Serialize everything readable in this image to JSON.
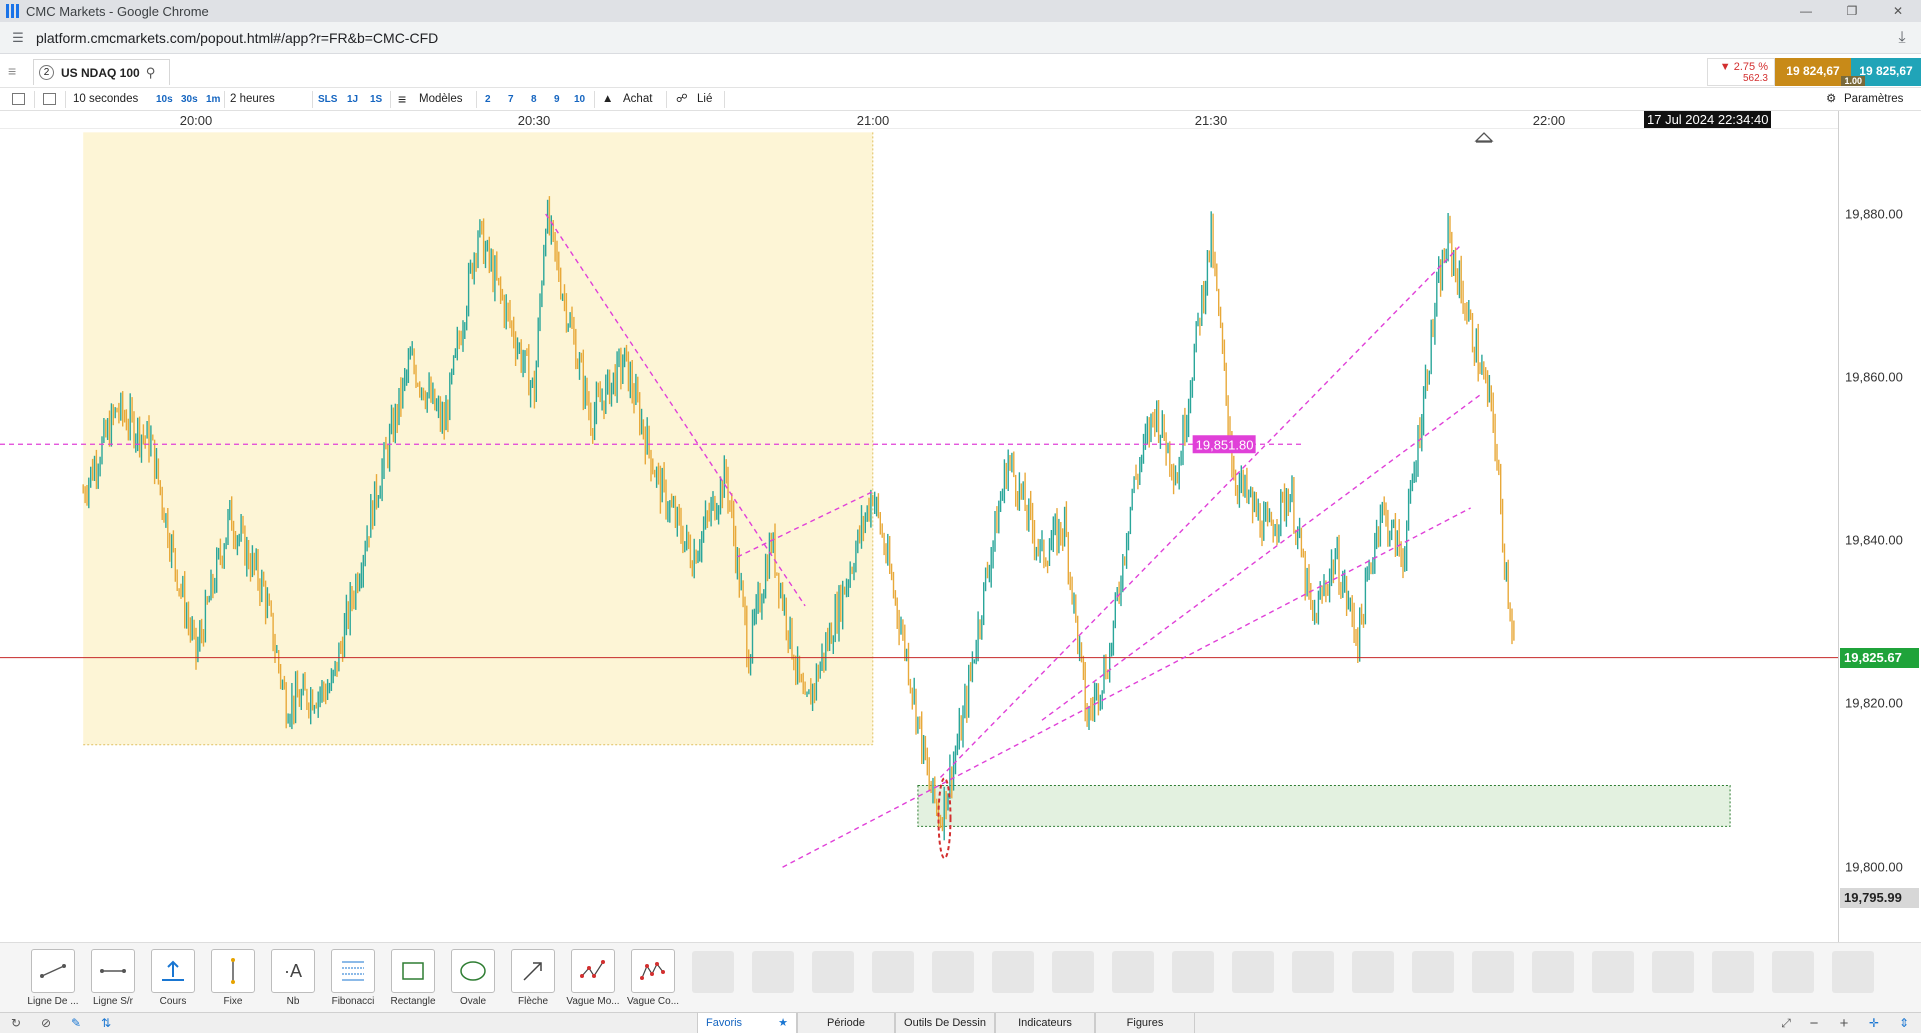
{
  "window": {
    "title": "CMC Markets - Google Chrome",
    "url": "platform.cmcmarkets.com/popout.html#/app?r=FR&b=CMC-CFD"
  },
  "instrument": {
    "number": "2",
    "name": "US NDAQ 100",
    "change_pct": "▼ 2.75 %",
    "change_pts": "562.3",
    "sell": "19 824,67",
    "buy": "19 825,67",
    "spread": "1.00"
  },
  "toolbar": {
    "interval": "10 secondes",
    "interval_options": [
      "10s",
      "30s",
      "1m"
    ],
    "span": "2 heures",
    "span_options": [
      "SLS",
      "1J",
      "1S"
    ],
    "templates": "Modèles",
    "template_nums": [
      "2",
      "7",
      "8",
      "9",
      "10"
    ],
    "buy_label": "Achat",
    "link_label": "Lié",
    "settings_label": "Paramètres"
  },
  "time_axis": {
    "labels": [
      "20:00",
      "20:30",
      "21:00",
      "21:30",
      "22:00"
    ],
    "datetime": "17 Jul 2024 22:34:40"
  },
  "price_axis": {
    "labels": [
      "19,880.00",
      "19,860.00",
      "19,840.00",
      "19,820.00",
      "19,800.00"
    ],
    "current_price": "19,825.67",
    "lower_label": "19,795.99"
  },
  "chart_data": {
    "type": "candlestick",
    "instrument": "US NDAQ 100",
    "timeframe": "10 secondes",
    "x_range": [
      "19:50",
      "22:35"
    ],
    "ylim": [
      19792,
      19890
    ],
    "horizontal_line_label": "19,851.80",
    "horizontal_line_price": 19851.8,
    "current_price_line": 19825.67,
    "path_points": [
      {
        "t": "19:50",
        "p": 19846
      },
      {
        "t": "19:53",
        "p": 19856
      },
      {
        "t": "19:56",
        "p": 19852
      },
      {
        "t": "19:58",
        "p": 19838
      },
      {
        "t": "20:00",
        "p": 19826
      },
      {
        "t": "20:03",
        "p": 19843
      },
      {
        "t": "20:06",
        "p": 19834
      },
      {
        "t": "20:08",
        "p": 19820
      },
      {
        "t": "20:12",
        "p": 19822
      },
      {
        "t": "20:16",
        "p": 19846
      },
      {
        "t": "20:19",
        "p": 19862
      },
      {
        "t": "20:22",
        "p": 19854
      },
      {
        "t": "20:25",
        "p": 19878
      },
      {
        "t": "20:28",
        "p": 19866
      },
      {
        "t": "20:30",
        "p": 19858
      },
      {
        "t": "20:31",
        "p": 19880
      },
      {
        "t": "20:35",
        "p": 19855
      },
      {
        "t": "20:38",
        "p": 19862
      },
      {
        "t": "20:41",
        "p": 19847
      },
      {
        "t": "20:44",
        "p": 19838
      },
      {
        "t": "20:47",
        "p": 19848
      },
      {
        "t": "20:49",
        "p": 19826
      },
      {
        "t": "20:51",
        "p": 19840
      },
      {
        "t": "20:54",
        "p": 19819
      },
      {
        "t": "20:57",
        "p": 19832
      },
      {
        "t": "21:00",
        "p": 19846
      },
      {
        "t": "21:03",
        "p": 19826
      },
      {
        "t": "21:05",
        "p": 19810
      },
      {
        "t": "21:06",
        "p": 19806
      },
      {
        "t": "21:08",
        "p": 19818
      },
      {
        "t": "21:10",
        "p": 19835
      },
      {
        "t": "21:12",
        "p": 19850
      },
      {
        "t": "21:15",
        "p": 19838
      },
      {
        "t": "21:17",
        "p": 19842
      },
      {
        "t": "21:19",
        "p": 19818
      },
      {
        "t": "21:21",
        "p": 19826
      },
      {
        "t": "21:23",
        "p": 19846
      },
      {
        "t": "21:25",
        "p": 19856
      },
      {
        "t": "21:27",
        "p": 19848
      },
      {
        "t": "21:29",
        "p": 19868
      },
      {
        "t": "21:30",
        "p": 19877
      },
      {
        "t": "21:32",
        "p": 19848
      },
      {
        "t": "21:35",
        "p": 19841
      },
      {
        "t": "21:37",
        "p": 19846
      },
      {
        "t": "21:39",
        "p": 19830
      },
      {
        "t": "21:41",
        "p": 19838
      },
      {
        "t": "21:43",
        "p": 19828
      },
      {
        "t": "21:45",
        "p": 19844
      },
      {
        "t": "21:47",
        "p": 19838
      },
      {
        "t": "21:50",
        "p": 19870
      },
      {
        "t": "21:51",
        "p": 19877
      },
      {
        "t": "21:53",
        "p": 19866
      },
      {
        "t": "21:55",
        "p": 19855
      },
      {
        "t": "21:56",
        "p": 19838
      },
      {
        "t": "21:57",
        "p": 19826
      }
    ],
    "trendlines": [
      {
        "from": {
          "t": "20:31",
          "p": 19880
        },
        "to": {
          "t": "20:54",
          "p": 19832
        }
      },
      {
        "from": {
          "t": "20:48",
          "p": 19838
        },
        "to": {
          "t": "21:00",
          "p": 19846
        }
      },
      {
        "from": {
          "t": "20:52",
          "p": 19800
        },
        "to": {
          "t": "21:53",
          "p": 19844
        }
      },
      {
        "from": {
          "t": "21:15",
          "p": 19818
        },
        "to": {
          "t": "21:54",
          "p": 19858
        }
      },
      {
        "from": {
          "t": "21:06",
          "p": 19811
        },
        "to": {
          "t": "21:52",
          "p": 19876
        }
      }
    ],
    "zones": [
      {
        "kind": "highlight",
        "from_t": "19:50",
        "to_t": "21:00",
        "p_high": 19890,
        "p_low": 19815,
        "color": "#fdf5d6"
      },
      {
        "kind": "demand",
        "from_t": "21:04",
        "to_t": "22:16",
        "p_high": 19810,
        "p_low": 19805,
        "color": "#e3f1e0"
      }
    ],
    "colors": {
      "up": "#2aa69a",
      "down": "#e8a93a",
      "trend": "#e040d8",
      "price_line": "#c62828"
    }
  },
  "draw_tools": [
    {
      "label": "Ligne De ...",
      "icon": "line-tool-icon"
    },
    {
      "label": "Ligne S/r",
      "icon": "sr-line-icon"
    },
    {
      "label": "Cours",
      "icon": "price-label-icon"
    },
    {
      "label": "Fixe",
      "icon": "vertical-line-icon"
    },
    {
      "label": "Nb",
      "icon": "text-tool-icon"
    },
    {
      "label": "Fibonacci",
      "icon": "fibonacci-icon"
    },
    {
      "label": "Rectangle",
      "icon": "rectangle-tool-icon"
    },
    {
      "label": "Ovale",
      "icon": "ellipse-tool-icon"
    },
    {
      "label": "Flèche",
      "icon": "arrow-tool-icon"
    },
    {
      "label": "Vague Mo...",
      "icon": "wave-tool-icon"
    },
    {
      "label": "Vague Co...",
      "icon": "wave-corrective-icon"
    }
  ],
  "bottom_tabs": [
    "Favoris",
    "Période",
    "Outils De Dessin",
    "Indicateurs",
    "Figures"
  ]
}
